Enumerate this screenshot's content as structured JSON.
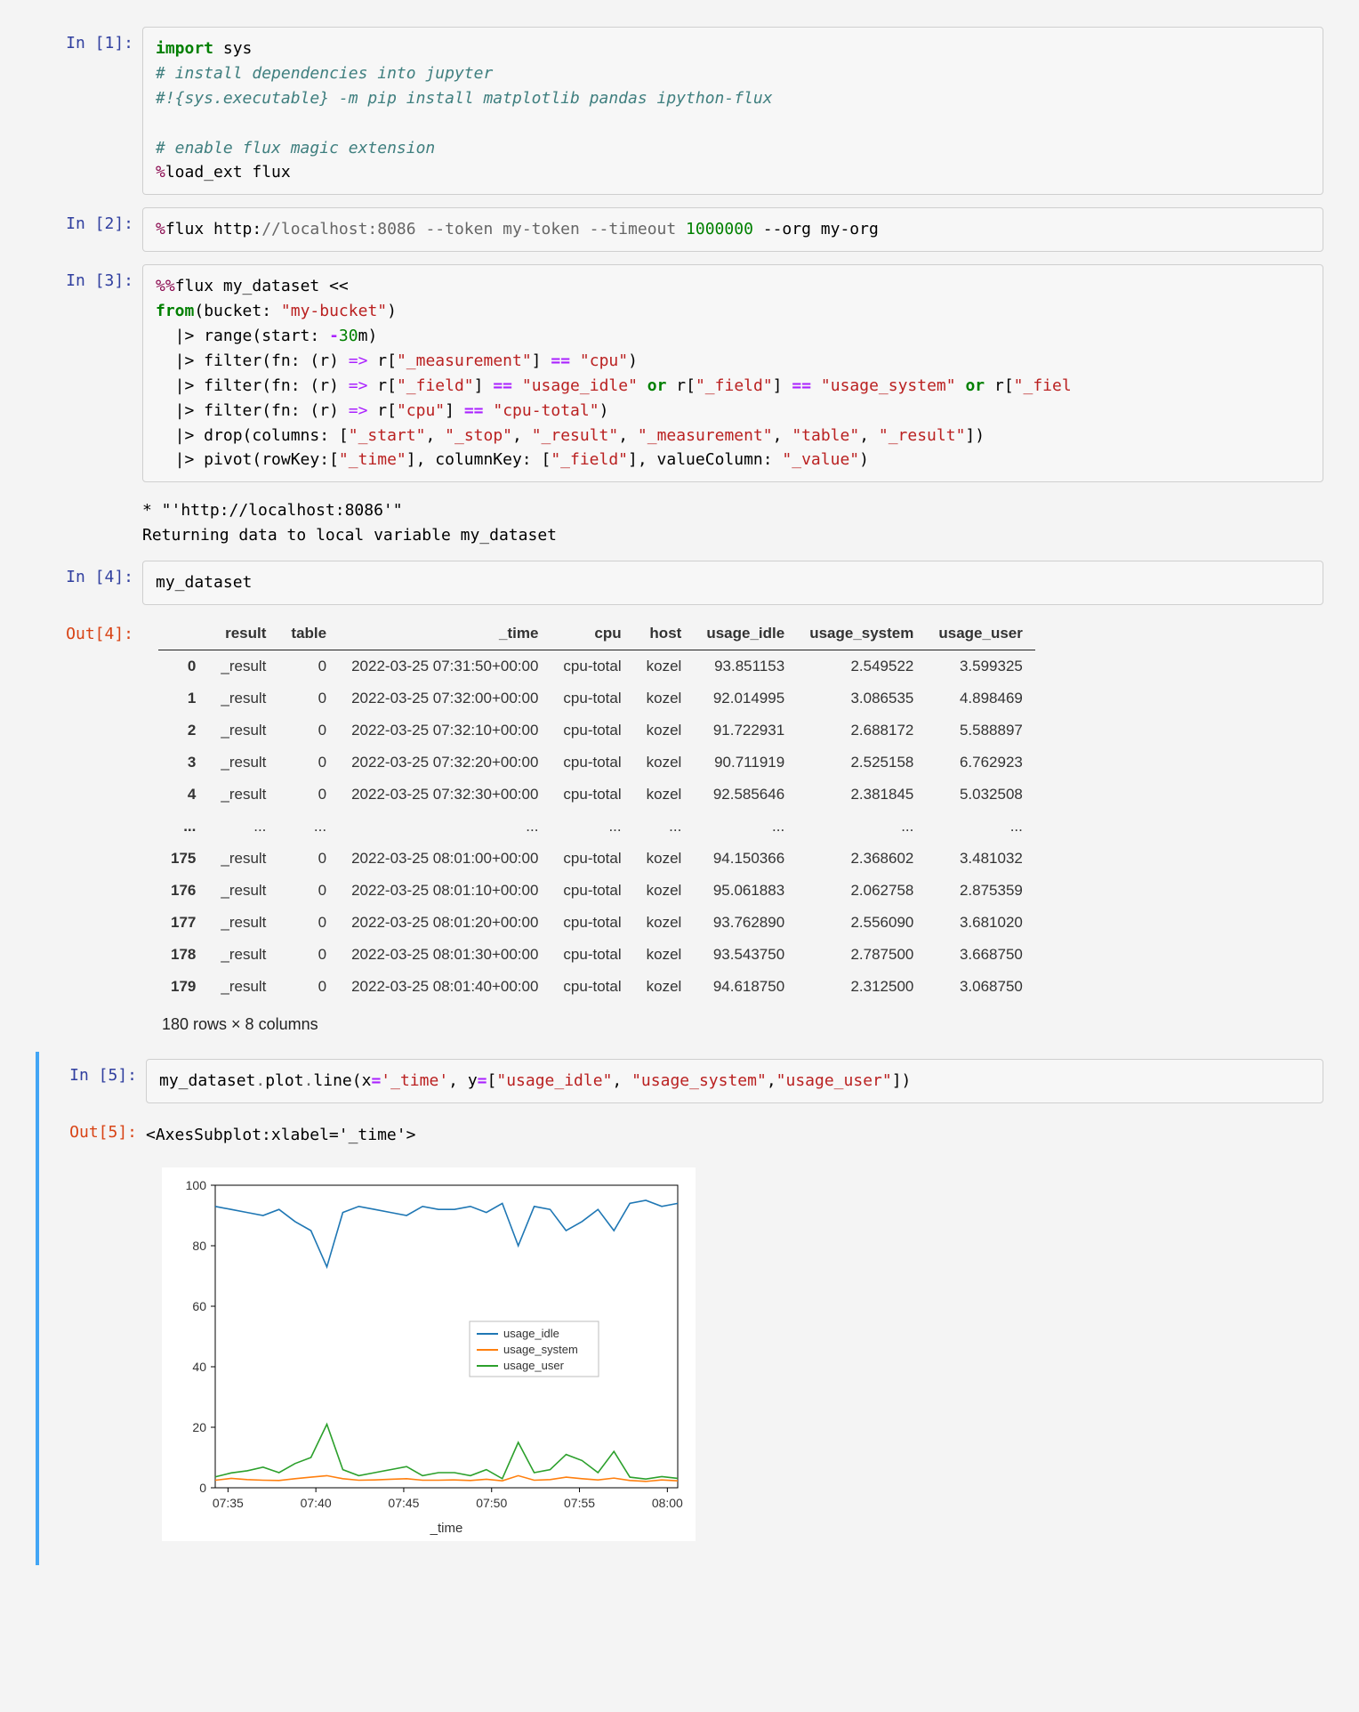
{
  "cells": {
    "c1_prompt": "In [1]:",
    "c2_prompt": "In [2]:",
    "c3_prompt": "In [3]:",
    "c4_prompt": "In [4]:",
    "c5_prompt": "In [5]:",
    "o4_prompt": "Out[4]:",
    "o5_prompt": "Out[5]:"
  },
  "code": {
    "c1_l1_a": "import",
    "c1_l1_b": " sys",
    "c1_l2": "# install dependencies into jupyter",
    "c1_l3": "#!{sys.executable} -m pip install matplotlib pandas ipython-flux",
    "c1_l4": "",
    "c1_l5": "# enable flux magic extension",
    "c1_l6_a": "%",
    "c1_l6_b": "load_ext flux",
    "c2_a": "%",
    "c2_b": "flux http:",
    "c2_c": "//localhost:8086 --token my-token --timeout ",
    "c2_d": "1000000",
    "c2_e": " --org my-org",
    "c3_l1_a": "%%",
    "c3_l1_b": "flux my_dataset <<",
    "c3_l2_a": "from",
    "c3_l2_b": "(bucket: ",
    "c3_l2_c": "\"my-bucket\"",
    "c3_l2_d": ")",
    "c3_l3_a": "  |> range(start: ",
    "c3_l3_b": "-",
    "c3_l3_c": "30",
    "c3_l3_d": "m)",
    "c3_l4_a": "  |> filter(fn: (r) ",
    "c3_l4_b": "=>",
    "c3_l4_c": " r[",
    "c3_l4_d": "\"_measurement\"",
    "c3_l4_e": "] ",
    "c3_l4_f": "==",
    "c3_l4_g": " ",
    "c3_l4_h": "\"cpu\"",
    "c3_l4_i": ")",
    "c3_l5_a": "  |> filter(fn: (r) ",
    "c3_l5_b": "=>",
    "c3_l5_c": " r[",
    "c3_l5_d": "\"_field\"",
    "c3_l5_e": "] ",
    "c3_l5_f": "==",
    "c3_l5_g": " ",
    "c3_l5_h": "\"usage_idle\"",
    "c3_l5_i": " ",
    "c3_l5_j": "or",
    "c3_l5_k": " r[",
    "c3_l5_l": "\"_field\"",
    "c3_l5_m": "] ",
    "c3_l5_n": "==",
    "c3_l5_o": " ",
    "c3_l5_p": "\"usage_system\"",
    "c3_l5_q": " ",
    "c3_l5_r": "or",
    "c3_l5_s": " r[",
    "c3_l5_t": "\"_fiel",
    "c3_l6_a": "  |> filter(fn: (r) ",
    "c3_l6_b": "=>",
    "c3_l6_c": " r[",
    "c3_l6_d": "\"cpu\"",
    "c3_l6_e": "] ",
    "c3_l6_f": "==",
    "c3_l6_g": " ",
    "c3_l6_h": "\"cpu-total\"",
    "c3_l6_i": ")",
    "c3_l7_a": "  |> drop(columns: [",
    "c3_l7_b": "\"_start\"",
    "c3_l7_c": ", ",
    "c3_l7_d": "\"_stop\"",
    "c3_l7_e": ", ",
    "c3_l7_f": "\"_result\"",
    "c3_l7_g": ", ",
    "c3_l7_h": "\"_measurement\"",
    "c3_l7_i": ", ",
    "c3_l7_j": "\"table\"",
    "c3_l7_k": ", ",
    "c3_l7_l": "\"_result\"",
    "c3_l7_m": "])",
    "c3_l8_a": "  |> pivot(rowKey:[",
    "c3_l8_b": "\"_time\"",
    "c3_l8_c": "], columnKey: [",
    "c3_l8_d": "\"_field\"",
    "c3_l8_e": "], valueColumn: ",
    "c3_l8_f": "\"_value\"",
    "c3_l8_g": ")",
    "c4": "my_dataset",
    "c5_a": "my_dataset",
    "c5_b": ".",
    "c5_c": "plot",
    "c5_d": ".",
    "c5_e": "line(x",
    "c5_f": "=",
    "c5_g": "'_time'",
    "c5_h": ", y",
    "c5_i": "=",
    "c5_j": "[",
    "c5_k": "\"usage_idle\"",
    "c5_l": ", ",
    "c5_m": "\"usage_system\"",
    "c5_n": ",",
    "c5_o": "\"usage_user\"",
    "c5_p": "])"
  },
  "out3_text": "* \"'http://localhost:8086'\"\nReturning data to local variable my_dataset",
  "out5_repr": "<AxesSubplot:xlabel='_time'>",
  "table": {
    "columns": [
      "",
      "result",
      "table",
      "_time",
      "cpu",
      "host",
      "usage_idle",
      "usage_system",
      "usage_user"
    ],
    "rows": [
      [
        "0",
        "_result",
        "0",
        "2022-03-25 07:31:50+00:00",
        "cpu-total",
        "kozel",
        "93.851153",
        "2.549522",
        "3.599325"
      ],
      [
        "1",
        "_result",
        "0",
        "2022-03-25 07:32:00+00:00",
        "cpu-total",
        "kozel",
        "92.014995",
        "3.086535",
        "4.898469"
      ],
      [
        "2",
        "_result",
        "0",
        "2022-03-25 07:32:10+00:00",
        "cpu-total",
        "kozel",
        "91.722931",
        "2.688172",
        "5.588897"
      ],
      [
        "3",
        "_result",
        "0",
        "2022-03-25 07:32:20+00:00",
        "cpu-total",
        "kozel",
        "90.711919",
        "2.525158",
        "6.762923"
      ],
      [
        "4",
        "_result",
        "0",
        "2022-03-25 07:32:30+00:00",
        "cpu-total",
        "kozel",
        "92.585646",
        "2.381845",
        "5.032508"
      ],
      [
        "...",
        "...",
        "...",
        "...",
        "...",
        "...",
        "...",
        "...",
        "..."
      ],
      [
        "175",
        "_result",
        "0",
        "2022-03-25 08:01:00+00:00",
        "cpu-total",
        "kozel",
        "94.150366",
        "2.368602",
        "3.481032"
      ],
      [
        "176",
        "_result",
        "0",
        "2022-03-25 08:01:10+00:00",
        "cpu-total",
        "kozel",
        "95.061883",
        "2.062758",
        "2.875359"
      ],
      [
        "177",
        "_result",
        "0",
        "2022-03-25 08:01:20+00:00",
        "cpu-total",
        "kozel",
        "93.762890",
        "2.556090",
        "3.681020"
      ],
      [
        "178",
        "_result",
        "0",
        "2022-03-25 08:01:30+00:00",
        "cpu-total",
        "kozel",
        "93.543750",
        "2.787500",
        "3.668750"
      ],
      [
        "179",
        "_result",
        "0",
        "2022-03-25 08:01:40+00:00",
        "cpu-total",
        "kozel",
        "94.618750",
        "2.312500",
        "3.068750"
      ]
    ],
    "summary": "180 rows × 8 columns"
  },
  "chart_data": {
    "type": "line",
    "xlabel": "_time",
    "ylabel": "",
    "ylim": [
      0,
      100
    ],
    "yticks": [
      0,
      20,
      40,
      60,
      80,
      100
    ],
    "xticks": [
      "07:35",
      "07:40",
      "07:45",
      "07:50",
      "07:55",
      "08:00"
    ],
    "x": [
      0,
      1,
      2,
      3,
      4,
      5,
      6,
      7,
      8,
      9,
      10,
      11,
      12,
      13,
      14,
      15,
      16,
      17,
      18,
      19,
      20,
      21,
      22,
      23,
      24,
      25,
      26,
      27,
      28,
      29
    ],
    "series": [
      {
        "name": "usage_idle",
        "color": "#1f77b4",
        "values": [
          93,
          92,
          91,
          90,
          92,
          88,
          85,
          73,
          91,
          93,
          92,
          91,
          90,
          93,
          92,
          92,
          93,
          91,
          94,
          80,
          93,
          92,
          85,
          88,
          92,
          85,
          94,
          95,
          93,
          94
        ]
      },
      {
        "name": "usage_system",
        "color": "#ff7f0e",
        "values": [
          2.5,
          3.1,
          2.7,
          2.5,
          2.4,
          3,
          3.5,
          4,
          3,
          2.5,
          2.6,
          2.8,
          3,
          2.5,
          2.5,
          2.6,
          2.4,
          2.8,
          2.3,
          4,
          2.5,
          2.7,
          3.5,
          3,
          2.6,
          3.2,
          2.4,
          2.1,
          2.6,
          2.3
        ]
      },
      {
        "name": "usage_user",
        "color": "#2ca02c",
        "values": [
          3.6,
          4.9,
          5.6,
          6.8,
          5.0,
          8,
          10,
          21,
          6,
          4,
          5,
          6,
          7,
          4,
          5,
          5,
          4,
          6,
          3,
          15,
          5,
          6,
          11,
          9,
          5,
          12,
          3.5,
          2.9,
          3.7,
          3.1
        ]
      }
    ],
    "legend": [
      "usage_idle",
      "usage_system",
      "usage_user"
    ]
  }
}
